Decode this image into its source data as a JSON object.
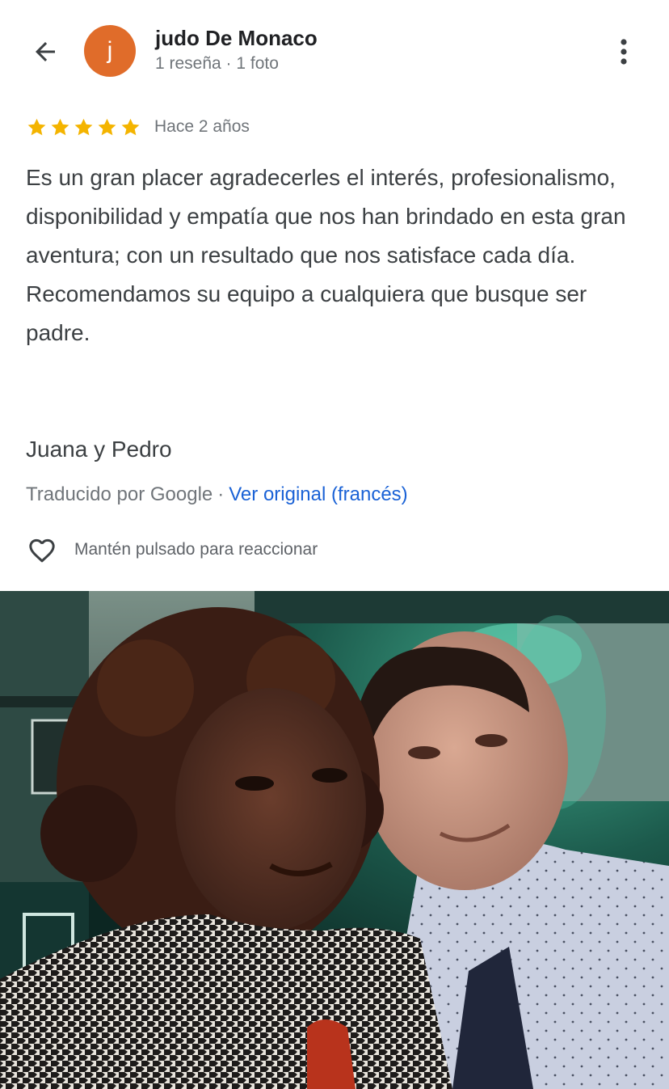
{
  "header": {
    "back_icon": "arrow-left-icon",
    "avatar_letter": "j",
    "avatar_color": "#e06c2a",
    "reviewer_name": "judo De Monaco",
    "reviewer_meta": "1 reseña · 1 foto",
    "more_icon": "more-vertical-icon"
  },
  "review": {
    "rating": 5,
    "rating_max": 5,
    "star_color": "#f4b400",
    "time_ago": "Hace 2 años",
    "text": "Es un gran placer agradecerles el interés, profesionalismo, disponibilidad y empatía que nos han brindado en esta gran aventura; con un resultado que nos satisface cada día. Recomendamos su equipo a cualquiera que busque ser padre.",
    "signature": "Juana y Pedro",
    "translated_by": "Traducido por Google",
    "separator": "·",
    "see_original": "Ver original (francés)",
    "link_color": "#1a62d6"
  },
  "reaction": {
    "icon": "heart-outline-icon",
    "label": "Mantén pulsado para reaccionar"
  },
  "photo": {
    "icon": "review-photo"
  }
}
